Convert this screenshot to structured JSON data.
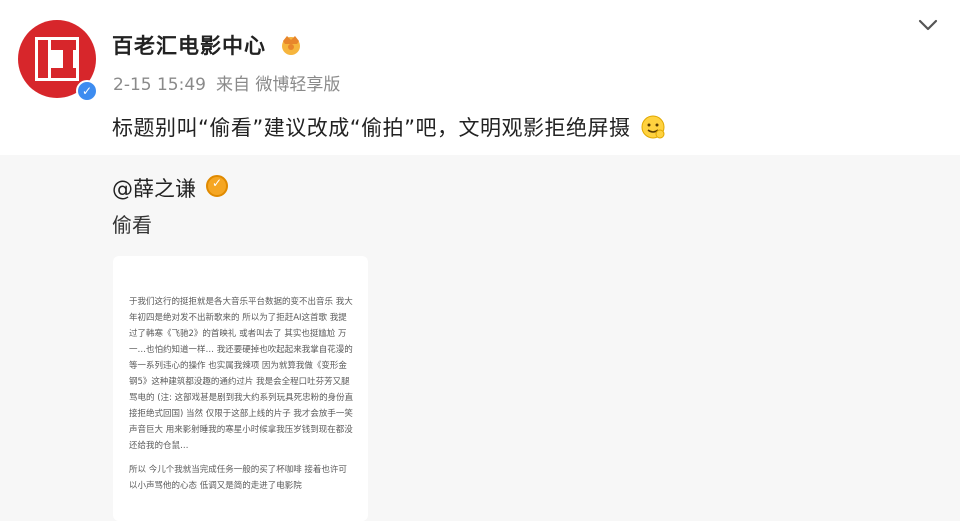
{
  "post": {
    "author": "百老汇电影中心",
    "date": "2-15 15:49",
    "source": "来自 微博轻享版",
    "text": "标题别叫“偷看”建议改成“偷拍”吧，文明观影拒绝屏摄",
    "icons": {
      "avatar": "broadway-logo",
      "verified": "verified-badge-icon",
      "crown": "crown-icon",
      "more": "chevron-down-icon",
      "emoji": "smile-emoji-icon"
    }
  },
  "repost": {
    "author": "@薛之谦",
    "text": "偷看",
    "badge_icon": "gold-verified-icon",
    "image_note": {
      "para1": "于我们这行的挺拒就是各大音乐平台数据的变不出音乐 我大年初四是绝对发不出新歌来的 所以为了拒赶AI这首歌 我提过了韩寒《飞驰2》的首映礼 或者叫去了 其实也挺尴尬 万一…也怕约知道一样… 我还要硬掉也吹起起来我掌自花漫的等一系列违心的操作 也实属我辣项 因为就算我做《变形金钢5》这种建筑都没趣的通约过片 我是会全程口吐芬芳又腿骂电的 (注: 这部戏甚是剧到我大约系列玩具死忠粉的身份直接拒绝式回国) 当然 仅限于这部上线的片子 我才会放手一笑 声音巨大 用来影射睡我的寒星小时候拿我压岁钱到现在都没还给我的仓鼠…",
      "para2": "所以 今儿个我就当完成任务一般的买了杯咖啡 接着也许可以小声骂他的心态 低调又是简的走进了电影院"
    }
  },
  "colors": {
    "brand_red": "#d7262b",
    "verified_blue": "#3d8cf0",
    "badge_gold": "#f5a623",
    "repost_bg": "#f7f7f7"
  }
}
